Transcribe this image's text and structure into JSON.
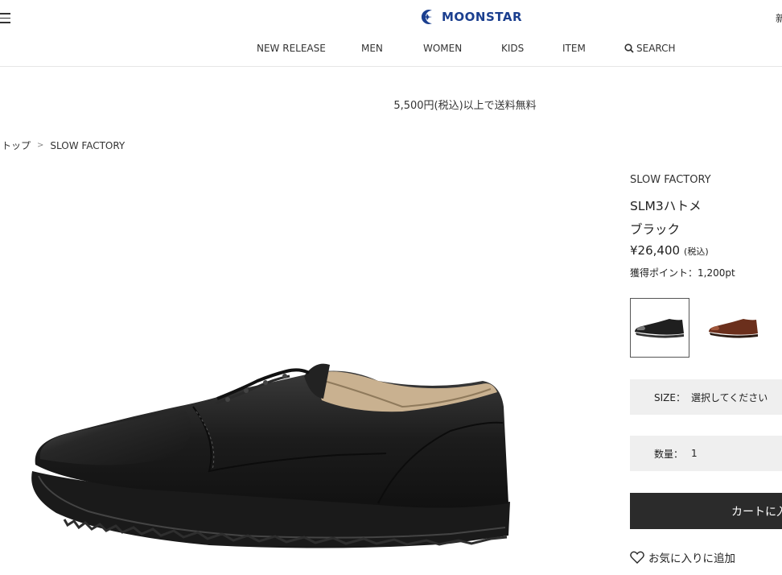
{
  "header": {
    "logo_text": "MOONSTAR",
    "corner_text": "新",
    "brand_color": "#1b3f8f"
  },
  "nav": {
    "items": [
      "NEW RELEASE",
      "MEN",
      "WOMEN",
      "KIDS",
      "ITEM"
    ],
    "search_label": "SEARCH"
  },
  "banner": {
    "shipping": "5,500円(税込)以上で送料無料"
  },
  "breadcrumb": {
    "home": "トップ",
    "separator": ">",
    "current": "SLOW FACTORY"
  },
  "product": {
    "brand": "SLOW FACTORY",
    "name": "SLM3ハトメ",
    "color": "ブラック",
    "price": "¥26,400",
    "tax_note": "(税込)",
    "points": "獲得ポイント：1,200pt",
    "variants": [
      "black",
      "brown"
    ]
  },
  "options": {
    "size_label": "SIZE：",
    "size_placeholder": "選択してください",
    "qty_label": "数量：",
    "qty_value": "1"
  },
  "actions": {
    "cart_label": "カートに入れる",
    "favorite_label": "お気に入りに追加"
  }
}
